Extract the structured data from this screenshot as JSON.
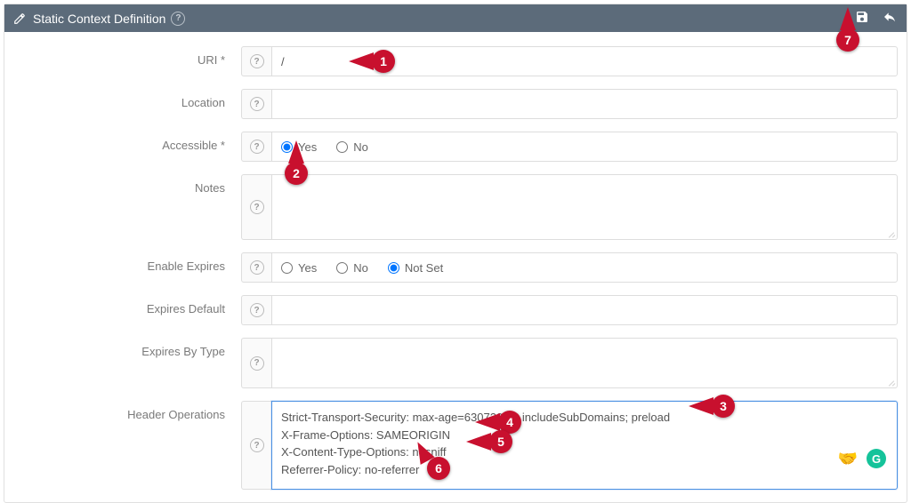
{
  "panel": {
    "title": "Static Context Definition"
  },
  "form": {
    "uri": {
      "label": "URI *",
      "value": "/"
    },
    "location": {
      "label": "Location",
      "value": ""
    },
    "accessible": {
      "label": "Accessible *",
      "options": {
        "yes": "Yes",
        "no": "No"
      },
      "selected": "yes"
    },
    "notes": {
      "label": "Notes",
      "value": ""
    },
    "enable_expires": {
      "label": "Enable Expires",
      "options": {
        "yes": "Yes",
        "no": "No",
        "notset": "Not Set"
      },
      "selected": "notset"
    },
    "expires_default": {
      "label": "Expires Default",
      "value": ""
    },
    "expires_by_type": {
      "label": "Expires By Type",
      "value": ""
    },
    "header_ops": {
      "label": "Header Operations",
      "value": "Strict-Transport-Security: max-age=63072000; includeSubDomains; preload\nX-Frame-Options: SAMEORIGIN\nX-Content-Type-Options: nosniff\nReferrer-Policy: no-referrer"
    }
  },
  "callouts": {
    "c1": "1",
    "c2": "2",
    "c3": "3",
    "c4": "4",
    "c5": "5",
    "c6": "6",
    "c7": "7"
  }
}
